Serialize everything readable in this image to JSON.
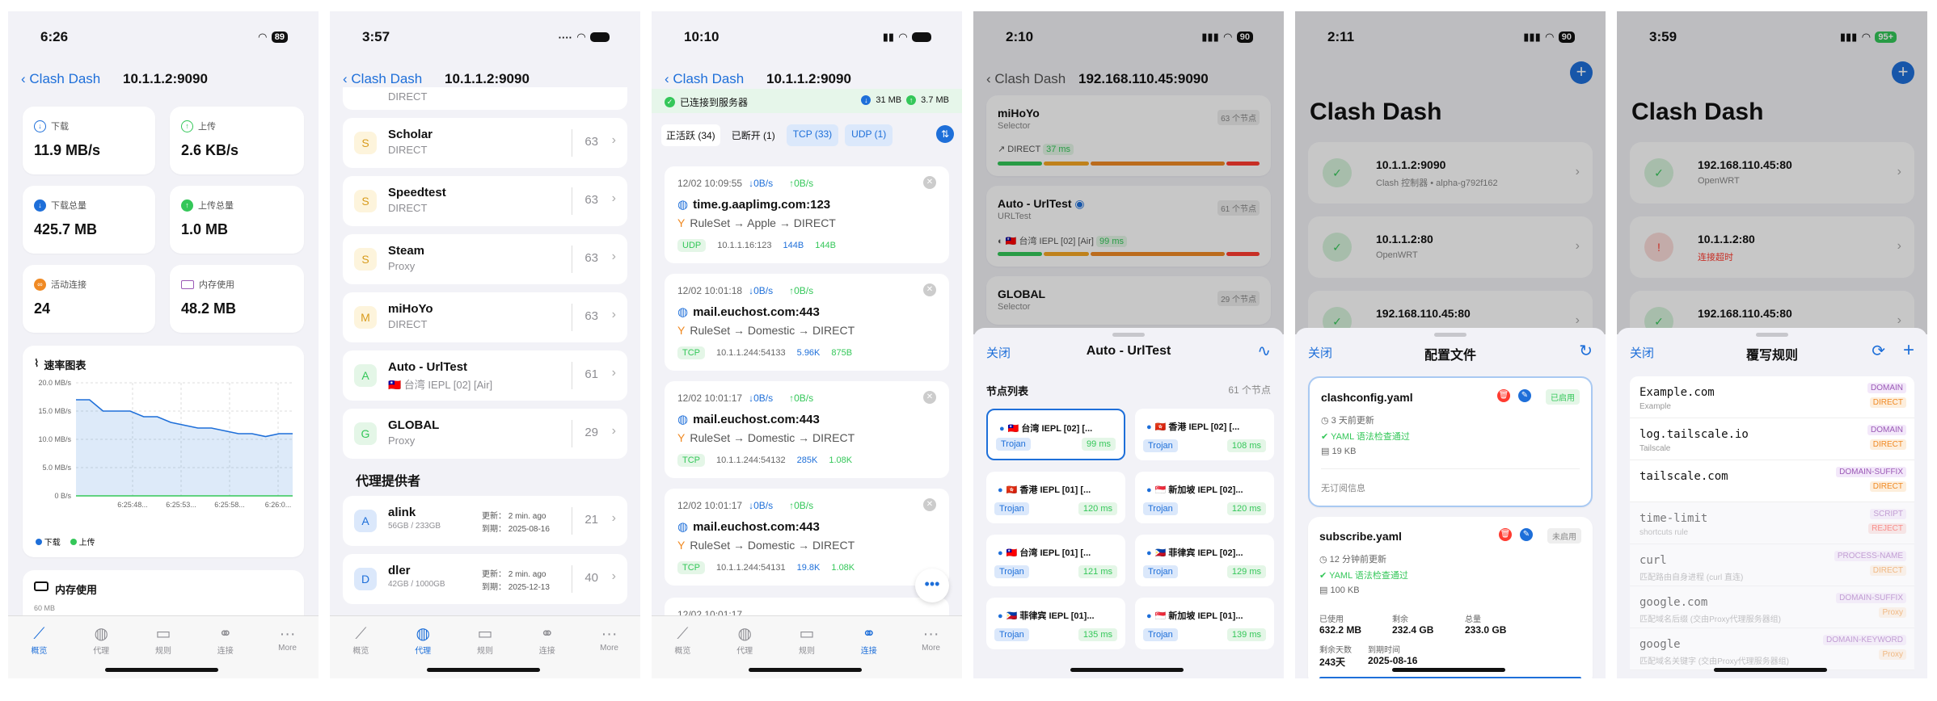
{
  "colors": {
    "accent": "#1e6fd9",
    "green": "#34c759",
    "orange": "#f08a24",
    "red": "#ff3b30",
    "purple": "#9b59b6"
  },
  "tabs": [
    "概览",
    "代理",
    "规则",
    "连接",
    "More"
  ],
  "p1": {
    "time": "6:26",
    "batt": "89",
    "back": "Clash Dash",
    "title": "10.1.1.2:9090",
    "stats": [
      {
        "label": "下载",
        "value": "11.9 MB/s"
      },
      {
        "label": "上传",
        "value": "2.6 KB/s"
      },
      {
        "label": "下载总量",
        "value": "425.7 MB"
      },
      {
        "label": "上传总量",
        "value": "1.0 MB"
      },
      {
        "label": "活动连接",
        "value": "24"
      },
      {
        "label": "内存使用",
        "value": "48.2 MB"
      }
    ],
    "chart_title": "速率图表",
    "mem_title": "内存使用",
    "mem_tick": "60 MB"
  },
  "chart_data": {
    "type": "area",
    "title": "速率图表",
    "yticks": [
      "20.0 MB/s",
      "15.0 MB/s",
      "10.0 MB/s",
      "5.0 MB/s",
      "0 B/s"
    ],
    "ylim": [
      0,
      20
    ],
    "x": [
      "6:25:48...",
      "6:25:53...",
      "6:25:58...",
      "6:26:0..."
    ],
    "series": [
      {
        "name": "下载",
        "values": [
          17,
          17,
          15,
          15,
          15,
          14,
          14,
          13,
          12.5,
          12,
          12,
          11.5,
          11,
          11,
          10.5,
          11,
          11
        ]
      },
      {
        "name": "上传",
        "values": [
          0,
          0,
          0,
          0,
          0,
          0,
          0,
          0,
          0,
          0,
          0,
          0,
          0,
          0,
          0,
          0,
          0
        ]
      }
    ]
  },
  "p2": {
    "time": "3:57",
    "back": "Clash Dash",
    "title": "10.1.1.2:9090",
    "top_sub": "DIRECT",
    "groups": [
      {
        "letter": "S",
        "name": "Scholar",
        "sub": "DIRECT",
        "count": "63"
      },
      {
        "letter": "S",
        "name": "Speedtest",
        "sub": "DIRECT",
        "count": "63"
      },
      {
        "letter": "S",
        "name": "Steam",
        "sub": "Proxy",
        "count": "63"
      },
      {
        "letter": "M",
        "name": "miHoYo",
        "sub": "DIRECT",
        "count": "63"
      },
      {
        "letter": "A",
        "name": "Auto - UrlTest",
        "sub": "🇹🇼 台湾 IEPL [02] [Air]",
        "count": "61"
      },
      {
        "letter": "G",
        "name": "GLOBAL",
        "sub": "Proxy",
        "count": "29"
      }
    ],
    "providers_title": "代理提供者",
    "providers": [
      {
        "letter": "A",
        "name": "alink",
        "sub": "56GB / 233GB",
        "upd": "更新： 2 min. ago",
        "exp": "到期： 2025-08-16",
        "count": "21"
      },
      {
        "letter": "D",
        "name": "dler",
        "sub": "42GB / 1000GB",
        "upd": "更新： 2 min. ago",
        "exp": "到期： 2025-12-13",
        "count": "40"
      }
    ]
  },
  "p3": {
    "time": "10:10",
    "back": "Clash Dash",
    "title": "10.1.1.2:9090",
    "banner": "已连接到服务器",
    "dl": "31 MB",
    "ul": "3.7 MB",
    "filters": [
      "正活跃 (34)",
      "已断开 (1)",
      "TCP (33)",
      "UDP (1)"
    ],
    "conns": [
      {
        "ts": "12/02 10:09:55",
        "down": "↓0B/s",
        "up": "↑0B/s",
        "host": "time.g.aaplimg.com:123",
        "rule": "RuleSet → Apple → DIRECT",
        "proto": "UDP",
        "ip": "10.1.1.16:123",
        "dl": "144B",
        "ul": "144B"
      },
      {
        "ts": "12/02 10:01:18",
        "down": "↓0B/s",
        "up": "↑0B/s",
        "host": "mail.euchost.com:443",
        "rule": "RuleSet → Domestic → DIRECT",
        "proto": "TCP",
        "ip": "10.1.1.244:54133",
        "dl": "5.96K",
        "ul": "875B"
      },
      {
        "ts": "12/02 10:01:17",
        "down": "↓0B/s",
        "up": "↑0B/s",
        "host": "mail.euchost.com:443",
        "rule": "RuleSet → Domestic → DIRECT",
        "proto": "TCP",
        "ip": "10.1.1.244:54132",
        "dl": "285K",
        "ul": "1.08K"
      },
      {
        "ts": "12/02 10:01:17",
        "down": "↓0B/s",
        "up": "↑0B/s",
        "host": "mail.euchost.com:443",
        "rule": "RuleSet → Domestic → DIRECT",
        "proto": "TCP",
        "ip": "10.1.1.244:54131",
        "dl": "19.8K",
        "ul": "1.08K"
      }
    ],
    "last_ts": "12/02 10:01:17"
  },
  "p4": {
    "time": "2:10",
    "batt": "90",
    "back": "Clash Dash",
    "title": "192.168.110.45:9090",
    "bg_groups": [
      {
        "name": "miHoYo",
        "type": "Selector",
        "count": "63 个节点",
        "sel": "DIRECT",
        "ms": "37 ms"
      },
      {
        "name": "Auto - UrlTest",
        "type": "URLTest",
        "count": "61 个节点",
        "sel": "🇹🇼 台湾 IEPL [02] [Air]",
        "ms": "99 ms"
      },
      {
        "name": "GLOBAL",
        "type": "Selector",
        "count": "29 个节点"
      }
    ],
    "sheet_close": "关闭",
    "sheet_title": "Auto - UrlTest",
    "list_title": "节点列表",
    "list_count": "61 个节点",
    "nodes": [
      {
        "name": "🇹🇼 台湾 IEPL [02] [...",
        "type": "Trojan",
        "ms": "99 ms"
      },
      {
        "name": "🇭🇰 香港 IEPL [02] [...",
        "type": "Trojan",
        "ms": "108 ms"
      },
      {
        "name": "🇭🇰 香港 IEPL [01] [...",
        "type": "Trojan",
        "ms": "120 ms"
      },
      {
        "name": "🇸🇬 新加坡 IEPL [02]...",
        "type": "Trojan",
        "ms": "120 ms"
      },
      {
        "name": "🇹🇼 台湾 IEPL [01] [...",
        "type": "Trojan",
        "ms": "121 ms"
      },
      {
        "name": "🇵🇭 菲律宾 IEPL [02]...",
        "type": "Trojan",
        "ms": "129 ms"
      },
      {
        "name": "🇵🇭 菲律宾 IEPL [01]...",
        "type": "Trojan",
        "ms": "135 ms"
      },
      {
        "name": "🇸🇬 新加坡 IEPL [01]...",
        "type": "Trojan",
        "ms": "139 ms"
      }
    ]
  },
  "p5": {
    "time": "2:11",
    "batt": "90",
    "big": "Clash Dash",
    "servers": [
      {
        "h": "10.1.1.2:9090",
        "sub": "Clash 控制器 • alpha-g792f162"
      },
      {
        "h": "10.1.1.2:80",
        "sub": "OpenWRT"
      },
      {
        "h": "192.168.110.45:80",
        "sub": ""
      }
    ],
    "sheet_close": "关闭",
    "sheet_title": "配置文件",
    "configs": [
      {
        "name": "clashconfig.yaml",
        "state": "已启用",
        "upd": "3 天前更新",
        "check": "YAML 语法检查通过",
        "size": "19 KB",
        "note": "无订阅信息"
      },
      {
        "name": "subscribe.yaml",
        "state": "未启用",
        "upd": "12 分钟前更新",
        "check": "YAML 语法检查通过",
        "size": "100 KB"
      }
    ],
    "usage": {
      "l1": "已使用",
      "v1": "632.2 MB",
      "l2": "剩余",
      "v2": "232.4 GB",
      "l3": "总量",
      "v3": "233.0 GB",
      "l4": "剩余天数",
      "v4": "243天",
      "l5": "到期时间",
      "v5": "2025-08-16"
    }
  },
  "p6": {
    "time": "3:59",
    "batt": "95+",
    "big": "Clash Dash",
    "servers": [
      {
        "h": "192.168.110.45:80",
        "sub": "OpenWRT"
      },
      {
        "h": "10.1.1.2:80",
        "sub": "连接超时"
      },
      {
        "h": "192.168.110.45:80",
        "sub": ""
      }
    ],
    "sheet_close": "关闭",
    "sheet_title": "覆写规则",
    "rules": [
      {
        "v": "Example.com",
        "s": "Example",
        "t": "DOMAIN",
        "a": "DIRECT"
      },
      {
        "v": "log.tailscale.io",
        "s": "Tailscale",
        "t": "DOMAIN",
        "a": "DIRECT"
      },
      {
        "v": "tailscale.com",
        "s": "",
        "t": "DOMAIN-SUFFIX",
        "a": "DIRECT"
      },
      {
        "v": "time-limit",
        "s": "shortcuts rule",
        "t": "SCRIPT",
        "a": "REJECT"
      },
      {
        "v": "curl",
        "s": "匹配路由自身进程 (curl 直连)",
        "t": "PROCESS-NAME",
        "a": "DIRECT"
      },
      {
        "v": "google.com",
        "s": "匹配域名后缀 (交由Proxy代理服务器组)",
        "t": "DOMAIN-SUFFIX",
        "a": "Proxy"
      },
      {
        "v": "google",
        "s": "匹配域名关键字 (交由Proxy代理服务器组)",
        "t": "DOMAIN-KEYWORD",
        "a": "Proxy"
      }
    ]
  }
}
